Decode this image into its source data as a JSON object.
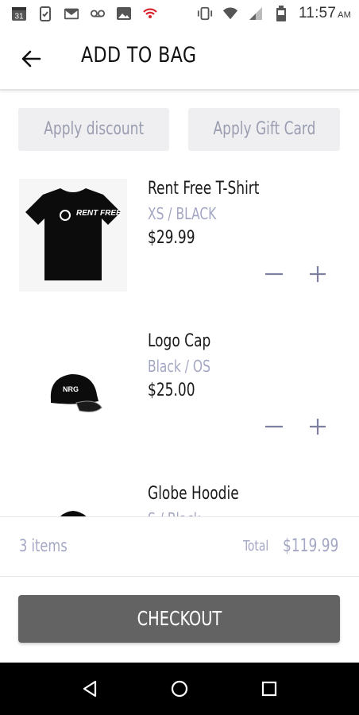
{
  "status_bar": {
    "time": "11:57",
    "ampm": "AM",
    "calendar_day": "31",
    "icons": [
      "calendar-icon",
      "clipboard-icon",
      "gmail-icon",
      "voicemail-icon",
      "image-icon",
      "hotspot-icon",
      "vibrate-icon",
      "wifi-icon",
      "signal-icon",
      "battery-icon"
    ]
  },
  "header": {
    "title": "ADD TO BAG"
  },
  "actions": {
    "discount_label": "Apply discount",
    "gift_label": "Apply Gift Card"
  },
  "items": [
    {
      "name": "Rent Free T-Shirt",
      "variant": "XS / BLACK",
      "price": "$29.99",
      "image": "tshirt-image",
      "logo_text": "RENT FREE"
    },
    {
      "name": "Logo Cap",
      "variant": "Black / OS",
      "price": "$25.00",
      "image": "cap-image",
      "logo_text": "NRG"
    },
    {
      "name": "Globe Hoodie",
      "variant": "S / Black",
      "price": "",
      "image": "hoodie-image"
    }
  ],
  "summary": {
    "count": "3 items",
    "total_label": "Total",
    "total_value": "$119.99"
  },
  "checkout": {
    "label": "CHECKOUT"
  },
  "colors": {
    "accent_muted": "#a4a7c4",
    "button_light": "#efeff1",
    "checkout_bg": "#636363",
    "nav_bg": "#000000"
  }
}
